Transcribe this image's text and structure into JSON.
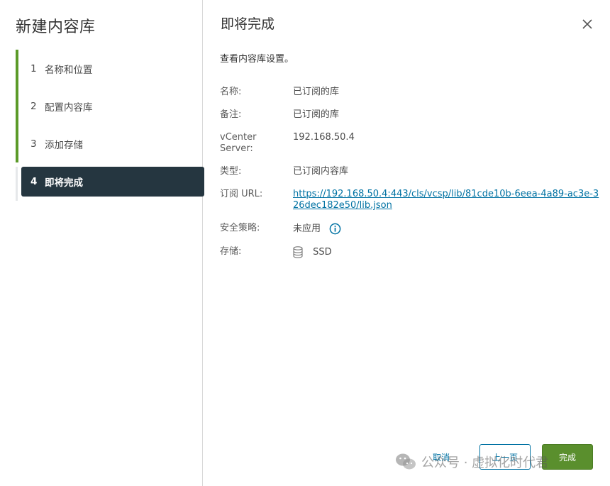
{
  "wizard": {
    "title": "新建内容库"
  },
  "steps": [
    {
      "num": "1",
      "label": "名称和位置",
      "state": "done"
    },
    {
      "num": "2",
      "label": "配置内容库",
      "state": "done"
    },
    {
      "num": "3",
      "label": "添加存储",
      "state": "done"
    },
    {
      "num": "4",
      "label": "即将完成",
      "state": "active"
    }
  ],
  "page": {
    "title": "即将完成",
    "subtitle": "查看内容库设置。",
    "close_icon": "close-icon"
  },
  "summary": {
    "name_label": "名称:",
    "name_value": "已订阅的库",
    "notes_label": "备注:",
    "notes_value": "已订阅的库",
    "vcenter_label": "vCenter Server:",
    "vcenter_value": "192.168.50.4",
    "type_label": "类型:",
    "type_value": "已订阅内容库",
    "url_label": "订阅 URL:",
    "url_value": "https://192.168.50.4:443/cls/vcsp/lib/81cde10b-6eea-4a89-ac3e-326dec182e50/lib.json",
    "policy_label": "安全策略:",
    "policy_value": "未应用",
    "storage_label": "存储:",
    "storage_value": "SSD"
  },
  "footer": {
    "cancel_label": "取消",
    "back_label": "上一页",
    "finish_label": "完成"
  },
  "watermark": {
    "text": "公众号 · 虚拟化时代君"
  },
  "colors": {
    "accent": "#0072a3",
    "step_done_bar": "#5b9a29",
    "step_active_bg": "#253640",
    "finish_button": "#5a8f2d"
  }
}
